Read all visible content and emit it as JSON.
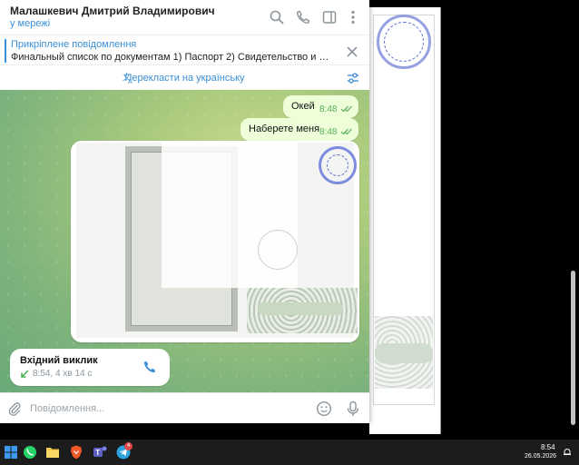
{
  "chat": {
    "name": "Малашкевич Дмитрий Владимирович",
    "status": "у мережі"
  },
  "pinned": {
    "title": "Прикріплене повідомлення",
    "text": "Финальный список по документам  1) Паспорт 2) Свидетельство и справк..."
  },
  "translate": {
    "label": "Перекласти на українську"
  },
  "messages": [
    {
      "text": "Окей",
      "time": "8:48",
      "status": "read"
    },
    {
      "text": "Наберете меня",
      "time": "8:48",
      "status": "read"
    }
  ],
  "call": {
    "title": "Вхідний виклик",
    "meta": "8:54, 4 хв 14 с"
  },
  "composer": {
    "placeholder": "Повідомлення..."
  },
  "taskbar": {
    "time": "8:54",
    "date": "26.05.2026",
    "telegram_badge": "4",
    "icons": [
      "windows-start-icon",
      "whatsapp-icon",
      "file-explorer-icon",
      "brave-browser-icon",
      "teams-icon",
      "telegram-icon"
    ]
  },
  "colors": {
    "accent": "#3a8fd6",
    "outgoing_bubble": "#eefed9",
    "read_check": "#5bb05b",
    "call_arrow": "#47b04b",
    "stamp": "#7d8be0"
  }
}
